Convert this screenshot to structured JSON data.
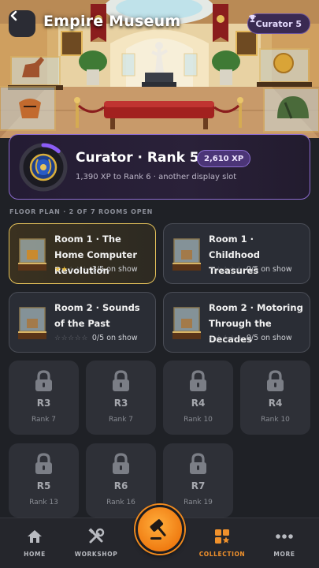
{
  "header": {
    "title": "Empire Museum",
    "curator_badge": "Curator 5"
  },
  "rank": {
    "title": "Curator · Rank 5",
    "xp": "2,610 XP",
    "subtitle": "1,390 XP to Rank 6 · another display slot",
    "progress": 0.65
  },
  "floor": {
    "label": "FLOOR PLAN · 2 OF 7 ROOMS OPEN"
  },
  "rooms": [
    {
      "name": "Room 1 · The Home Computer Revolution",
      "stars": 2,
      "on_show": "3/5 on show",
      "active": true
    },
    {
      "name": "Room 1 · Childhood Treasures",
      "stars": 0,
      "on_show": "0/5 on show",
      "active": false
    },
    {
      "name": "Room 2 · Sounds of the Past",
      "stars": 0,
      "on_show": "0/5 on show",
      "active": false
    },
    {
      "name": "Room 2 · Motoring Through the Decades",
      "stars": 0,
      "on_show": "0/5 on show",
      "active": false
    }
  ],
  "locked": [
    {
      "name": "R3",
      "rank": "Rank 7"
    },
    {
      "name": "R3",
      "rank": "Rank 7"
    },
    {
      "name": "R4",
      "rank": "Rank 10"
    },
    {
      "name": "R4",
      "rank": "Rank 10"
    },
    {
      "name": "R5",
      "rank": "Rank 13"
    },
    {
      "name": "R6",
      "rank": "Rank 16"
    },
    {
      "name": "R7",
      "rank": "Rank 19"
    }
  ],
  "nav": {
    "home": "HOME",
    "workshop": "WORKSHOP",
    "collection": "COLLECTION",
    "more": "MORE"
  },
  "colors": {
    "accent_orange": "#f0912c",
    "active_gold": "#e5c25a",
    "xp_purple": "#8c6ad0"
  }
}
